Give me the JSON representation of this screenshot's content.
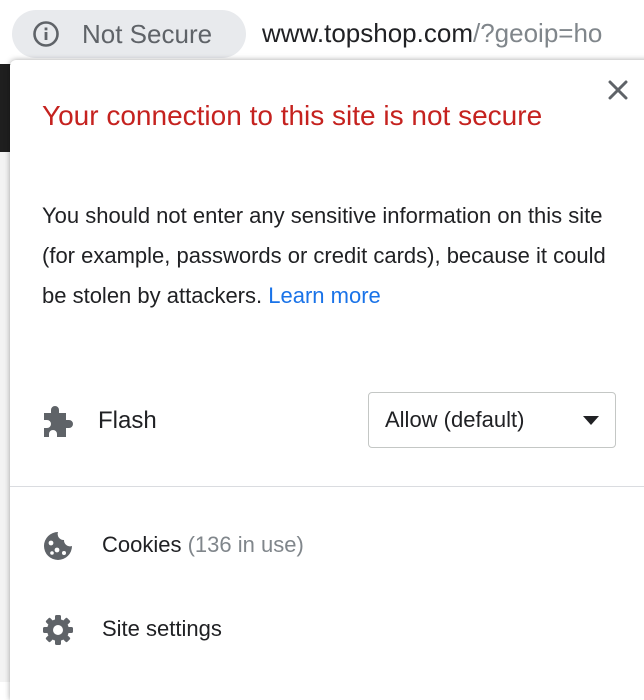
{
  "omnibox": {
    "security_label": "Not Secure",
    "url_host": "www.topshop.com",
    "url_rest": "/?geoip=ho"
  },
  "popup": {
    "title": "Your connection to this site is not secure",
    "description": "You should not enter any sensitive information on this site (for example, passwords or credit cards), because it could be stolen by attackers.",
    "learn_more": "Learn more",
    "flash": {
      "label": "Flash",
      "selected": "Allow (default)"
    },
    "cookies": {
      "label": "Cookies",
      "count": "(136 in use)"
    },
    "site_settings": {
      "label": "Site settings"
    }
  },
  "colors": {
    "title_red": "#c5221f",
    "link_blue": "#1a73e8",
    "chip_bg": "#e8eaed"
  },
  "icons": [
    "info-icon",
    "close-icon",
    "puzzle-piece-icon",
    "dropdown-caret-icon",
    "cookie-icon",
    "gear-icon"
  ]
}
